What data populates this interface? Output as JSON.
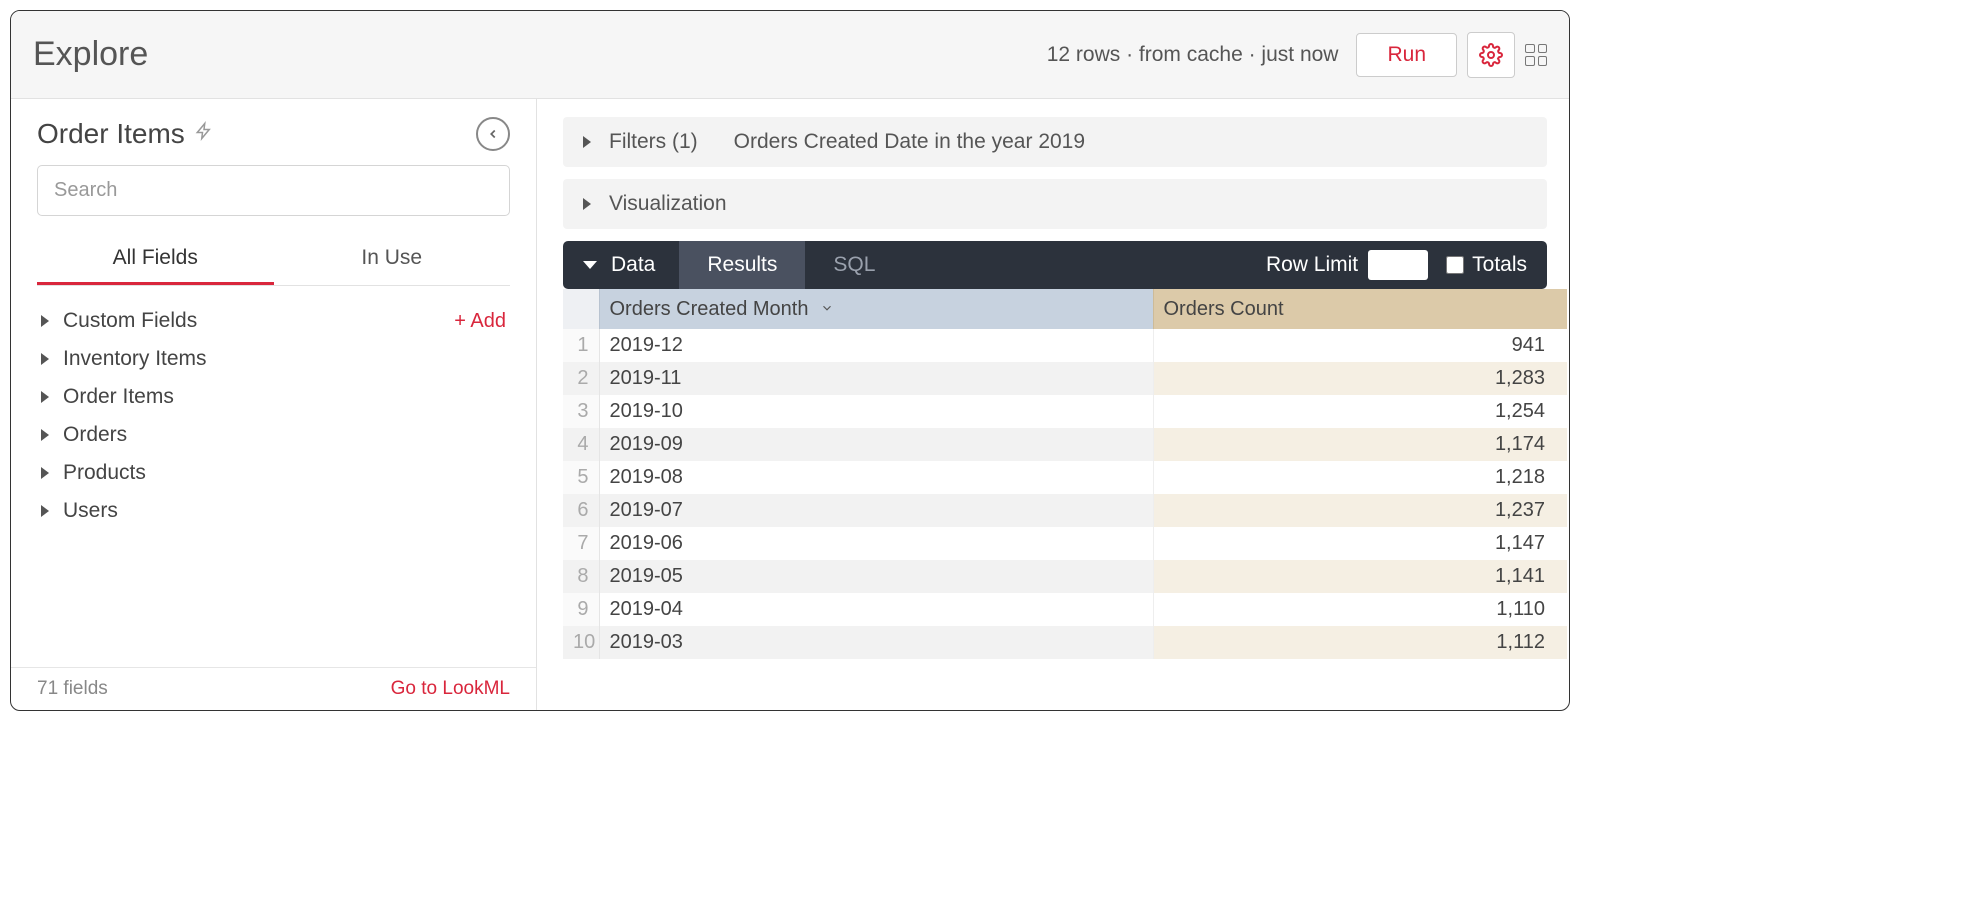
{
  "header": {
    "title": "Explore",
    "status": "12 rows  ·  from cache  ·  just now",
    "run_label": "Run"
  },
  "sidebar": {
    "explore_name": "Order Items",
    "search_placeholder": "Search",
    "tabs": {
      "all_fields": "All Fields",
      "in_use": "In Use"
    },
    "add_label": "+  Add",
    "groups": [
      {
        "label": "Custom Fields",
        "has_add": true
      },
      {
        "label": "Inventory Items"
      },
      {
        "label": "Order Items"
      },
      {
        "label": "Orders"
      },
      {
        "label": "Products"
      },
      {
        "label": "Users"
      }
    ],
    "footer": {
      "field_count": "71 fields",
      "lookml": "Go to LookML"
    }
  },
  "main": {
    "filters": {
      "label": "Filters (1)",
      "summary": "Orders Created Date in the year 2019"
    },
    "visualization_label": "Visualization",
    "data_bar": {
      "label": "Data",
      "results": "Results",
      "sql": "SQL",
      "row_limit_label": "Row Limit",
      "row_limit_value": "",
      "totals_label": "Totals"
    },
    "table": {
      "columns": {
        "month": "Orders Created Month",
        "count": "Orders Count"
      },
      "rows": [
        {
          "n": "1",
          "month": "2019-12",
          "count": "941"
        },
        {
          "n": "2",
          "month": "2019-11",
          "count": "1,283"
        },
        {
          "n": "3",
          "month": "2019-10",
          "count": "1,254"
        },
        {
          "n": "4",
          "month": "2019-09",
          "count": "1,174"
        },
        {
          "n": "5",
          "month": "2019-08",
          "count": "1,218"
        },
        {
          "n": "6",
          "month": "2019-07",
          "count": "1,237"
        },
        {
          "n": "7",
          "month": "2019-06",
          "count": "1,147"
        },
        {
          "n": "8",
          "month": "2019-05",
          "count": "1,141"
        },
        {
          "n": "9",
          "month": "2019-04",
          "count": "1,110"
        },
        {
          "n": "10",
          "month": "2019-03",
          "count": "1,112"
        }
      ]
    }
  }
}
